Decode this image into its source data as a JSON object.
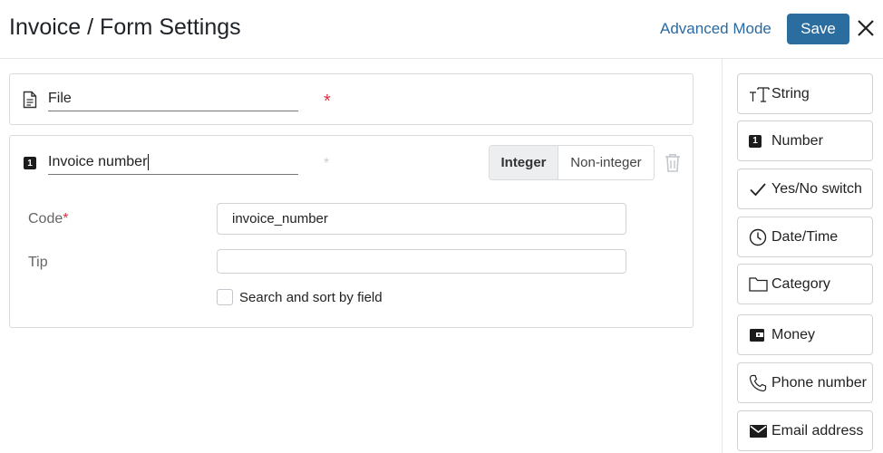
{
  "header": {
    "title": "Invoice / Form Settings",
    "advanced_mode_label": "Advanced Mode",
    "save_label": "Save",
    "close_icon": "close-icon"
  },
  "fields": [
    {
      "icon": "document-icon",
      "name": "File",
      "required_star": "*"
    },
    {
      "icon": "number-icon",
      "icon_text": "1",
      "name": "Invoice number",
      "required_star": "*",
      "number_type": {
        "options": [
          "Integer",
          "Non-integer"
        ],
        "selected": "Integer"
      },
      "delete_icon": "trash-icon",
      "properties": {
        "code_label": "Code",
        "code_required_star": "*",
        "code_value": "invoice_number",
        "tip_label": "Tip",
        "tip_value": "",
        "search_sort_label": "Search and sort by field",
        "search_sort_checked": false
      }
    }
  ],
  "field_types": [
    {
      "icon": "text-icon",
      "label": "String"
    },
    {
      "icon": "number-icon",
      "label": "Number",
      "icon_text": "1"
    },
    {
      "icon": "check-icon",
      "label": "Yes/No switch"
    },
    {
      "icon": "clock-icon",
      "label": "Date/Time"
    },
    {
      "icon": "folder-icon",
      "label": "Category"
    },
    {
      "icon": "wallet-icon",
      "label": "Money"
    },
    {
      "icon": "phone-icon",
      "label": "Phone number"
    },
    {
      "icon": "envelope-icon",
      "label": "Email address"
    }
  ],
  "colors": {
    "accent": "#2b6d9f",
    "link": "#2a6aa0",
    "required": "#d9333f"
  }
}
